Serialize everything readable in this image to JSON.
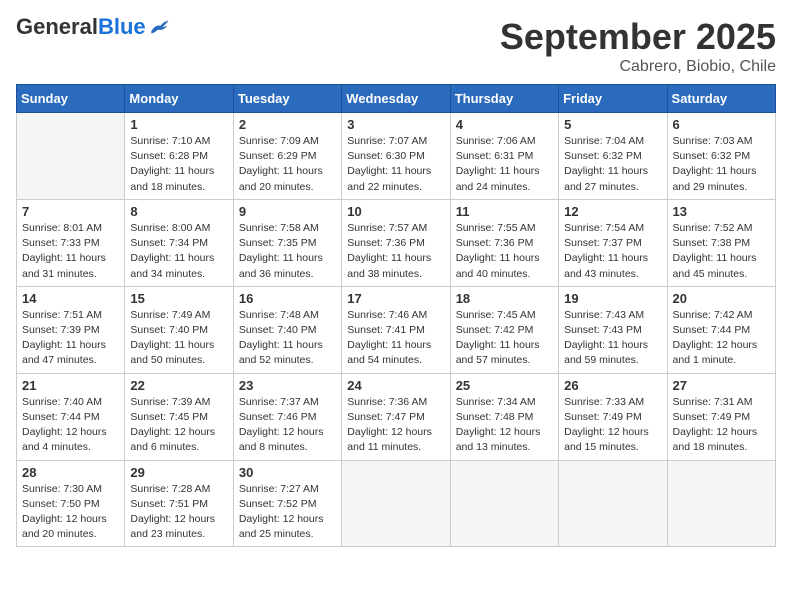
{
  "header": {
    "logo_general": "General",
    "logo_blue": "Blue",
    "month": "September 2025",
    "location": "Cabrero, Biobio, Chile"
  },
  "days_of_week": [
    "Sunday",
    "Monday",
    "Tuesday",
    "Wednesday",
    "Thursday",
    "Friday",
    "Saturday"
  ],
  "weeks": [
    [
      {
        "day": "",
        "info": ""
      },
      {
        "day": "1",
        "info": "Sunrise: 7:10 AM\nSunset: 6:28 PM\nDaylight: 11 hours\nand 18 minutes."
      },
      {
        "day": "2",
        "info": "Sunrise: 7:09 AM\nSunset: 6:29 PM\nDaylight: 11 hours\nand 20 minutes."
      },
      {
        "day": "3",
        "info": "Sunrise: 7:07 AM\nSunset: 6:30 PM\nDaylight: 11 hours\nand 22 minutes."
      },
      {
        "day": "4",
        "info": "Sunrise: 7:06 AM\nSunset: 6:31 PM\nDaylight: 11 hours\nand 24 minutes."
      },
      {
        "day": "5",
        "info": "Sunrise: 7:04 AM\nSunset: 6:32 PM\nDaylight: 11 hours\nand 27 minutes."
      },
      {
        "day": "6",
        "info": "Sunrise: 7:03 AM\nSunset: 6:32 PM\nDaylight: 11 hours\nand 29 minutes."
      }
    ],
    [
      {
        "day": "7",
        "info": "Sunrise: 8:01 AM\nSunset: 7:33 PM\nDaylight: 11 hours\nand 31 minutes."
      },
      {
        "day": "8",
        "info": "Sunrise: 8:00 AM\nSunset: 7:34 PM\nDaylight: 11 hours\nand 34 minutes."
      },
      {
        "day": "9",
        "info": "Sunrise: 7:58 AM\nSunset: 7:35 PM\nDaylight: 11 hours\nand 36 minutes."
      },
      {
        "day": "10",
        "info": "Sunrise: 7:57 AM\nSunset: 7:36 PM\nDaylight: 11 hours\nand 38 minutes."
      },
      {
        "day": "11",
        "info": "Sunrise: 7:55 AM\nSunset: 7:36 PM\nDaylight: 11 hours\nand 40 minutes."
      },
      {
        "day": "12",
        "info": "Sunrise: 7:54 AM\nSunset: 7:37 PM\nDaylight: 11 hours\nand 43 minutes."
      },
      {
        "day": "13",
        "info": "Sunrise: 7:52 AM\nSunset: 7:38 PM\nDaylight: 11 hours\nand 45 minutes."
      }
    ],
    [
      {
        "day": "14",
        "info": "Sunrise: 7:51 AM\nSunset: 7:39 PM\nDaylight: 11 hours\nand 47 minutes."
      },
      {
        "day": "15",
        "info": "Sunrise: 7:49 AM\nSunset: 7:40 PM\nDaylight: 11 hours\nand 50 minutes."
      },
      {
        "day": "16",
        "info": "Sunrise: 7:48 AM\nSunset: 7:40 PM\nDaylight: 11 hours\nand 52 minutes."
      },
      {
        "day": "17",
        "info": "Sunrise: 7:46 AM\nSunset: 7:41 PM\nDaylight: 11 hours\nand 54 minutes."
      },
      {
        "day": "18",
        "info": "Sunrise: 7:45 AM\nSunset: 7:42 PM\nDaylight: 11 hours\nand 57 minutes."
      },
      {
        "day": "19",
        "info": "Sunrise: 7:43 AM\nSunset: 7:43 PM\nDaylight: 11 hours\nand 59 minutes."
      },
      {
        "day": "20",
        "info": "Sunrise: 7:42 AM\nSunset: 7:44 PM\nDaylight: 12 hours\nand 1 minute."
      }
    ],
    [
      {
        "day": "21",
        "info": "Sunrise: 7:40 AM\nSunset: 7:44 PM\nDaylight: 12 hours\nand 4 minutes."
      },
      {
        "day": "22",
        "info": "Sunrise: 7:39 AM\nSunset: 7:45 PM\nDaylight: 12 hours\nand 6 minutes."
      },
      {
        "day": "23",
        "info": "Sunrise: 7:37 AM\nSunset: 7:46 PM\nDaylight: 12 hours\nand 8 minutes."
      },
      {
        "day": "24",
        "info": "Sunrise: 7:36 AM\nSunset: 7:47 PM\nDaylight: 12 hours\nand 11 minutes."
      },
      {
        "day": "25",
        "info": "Sunrise: 7:34 AM\nSunset: 7:48 PM\nDaylight: 12 hours\nand 13 minutes."
      },
      {
        "day": "26",
        "info": "Sunrise: 7:33 AM\nSunset: 7:49 PM\nDaylight: 12 hours\nand 15 minutes."
      },
      {
        "day": "27",
        "info": "Sunrise: 7:31 AM\nSunset: 7:49 PM\nDaylight: 12 hours\nand 18 minutes."
      }
    ],
    [
      {
        "day": "28",
        "info": "Sunrise: 7:30 AM\nSunset: 7:50 PM\nDaylight: 12 hours\nand 20 minutes."
      },
      {
        "day": "29",
        "info": "Sunrise: 7:28 AM\nSunset: 7:51 PM\nDaylight: 12 hours\nand 23 minutes."
      },
      {
        "day": "30",
        "info": "Sunrise: 7:27 AM\nSunset: 7:52 PM\nDaylight: 12 hours\nand 25 minutes."
      },
      {
        "day": "",
        "info": ""
      },
      {
        "day": "",
        "info": ""
      },
      {
        "day": "",
        "info": ""
      },
      {
        "day": "",
        "info": ""
      }
    ]
  ]
}
